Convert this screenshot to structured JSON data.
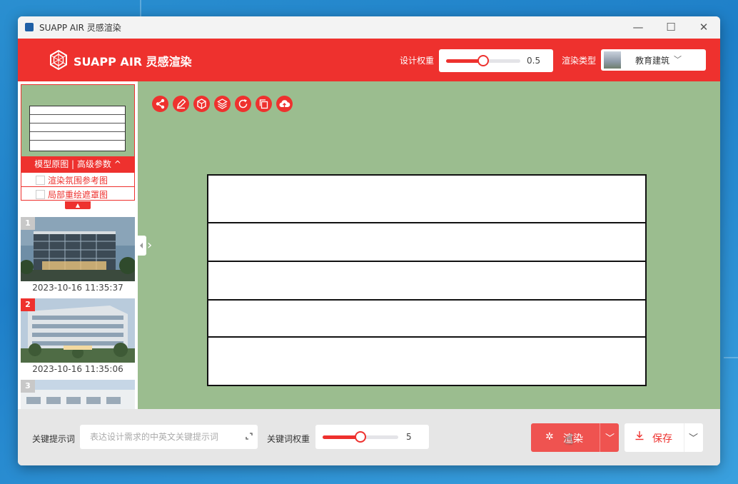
{
  "window": {
    "title": "SUAPP AIR 灵感渲染",
    "minimize": "—",
    "maximize": "☐",
    "close": "✕"
  },
  "header": {
    "brand": "SUAPP AIR 灵感渲染",
    "design_weight_label": "设计权重",
    "design_weight_value": "0.5",
    "design_weight_fraction": 0.5,
    "render_type_label": "渲染类型",
    "render_type_value": "教育建筑",
    "render_type_caret": "﹀"
  },
  "sidebar": {
    "model_tab_label": "模型原图 | 高级参数 ^",
    "options": [
      "渲染氛围参考图",
      "局部重绘遮罩图"
    ],
    "collapse_arrow": "▲",
    "history": [
      {
        "num": "1",
        "date": "2023-10-16 11:35:37"
      },
      {
        "num": "2",
        "date": "2023-10-16 11:35:06"
      },
      {
        "num": "3",
        "date": ""
      }
    ],
    "expand_arrow": "›"
  },
  "toolbar": {
    "icons": [
      "share-icon",
      "edit-icon",
      "cube-icon",
      "layers-icon",
      "refresh-icon",
      "copy-icon",
      "cloud-upload-icon"
    ]
  },
  "bottom": {
    "keyword_label": "关键提示词",
    "keyword_placeholder": "表达设计需求的中英文关键提示词",
    "keyword_weight_label": "关键词权重",
    "keyword_weight_value": "5",
    "keyword_weight_fraction": 0.5,
    "render_label": "渲染",
    "save_label": "保存",
    "caret": "﹀"
  },
  "colors": {
    "brand_red": "#ee312e",
    "canvas_green": "#9bbd8f",
    "render_button": "#ef5350"
  }
}
